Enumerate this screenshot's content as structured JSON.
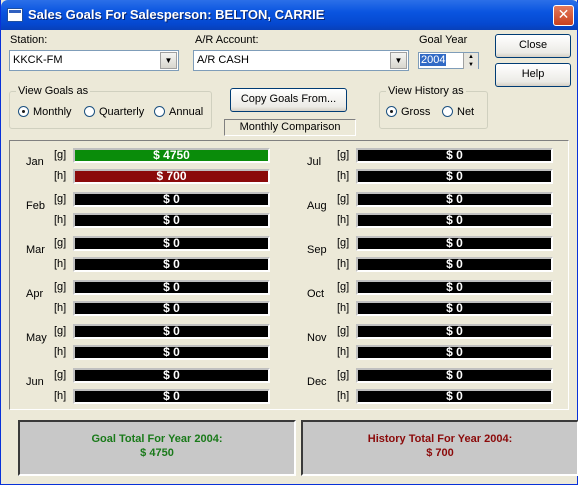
{
  "window": {
    "title": "Sales Goals For Salesperson: BELTON, CARRIE",
    "close_glyph": "✕"
  },
  "station": {
    "label": "Station:",
    "value": "KKCK-FM"
  },
  "ar_account": {
    "label": "A/R Account:",
    "value": "A/R CASH"
  },
  "goal_year": {
    "label": "Goal Year",
    "value": "2004"
  },
  "buttons": {
    "close": "Close",
    "help": "Help",
    "copy_goals": "Copy Goals From..."
  },
  "view_goals": {
    "title": "View Goals as",
    "options": [
      "Monthly",
      "Quarterly",
      "Annual"
    ],
    "selected": "Monthly"
  },
  "view_history": {
    "title": "View History as",
    "options": [
      "Gross",
      "Net"
    ],
    "selected": "Gross"
  },
  "comparison_label": "Monthly Comparison",
  "row_tags": {
    "goal": "[g]",
    "history": "[h]"
  },
  "months_left": [
    {
      "name": "Jan",
      "goal": "$ 4750",
      "history": "$ 700"
    },
    {
      "name": "Feb",
      "goal": "$ 0",
      "history": "$ 0"
    },
    {
      "name": "Mar",
      "goal": "$ 0",
      "history": "$ 0"
    },
    {
      "name": "Apr",
      "goal": "$ 0",
      "history": "$ 0"
    },
    {
      "name": "May",
      "goal": "$ 0",
      "history": "$ 0"
    },
    {
      "name": "Jun",
      "goal": "$ 0",
      "history": "$ 0"
    }
  ],
  "months_right": [
    {
      "name": "Jul",
      "goal": "$ 0",
      "history": "$ 0"
    },
    {
      "name": "Aug",
      "goal": "$ 0",
      "history": "$ 0"
    },
    {
      "name": "Sep",
      "goal": "$ 0",
      "history": "$ 0"
    },
    {
      "name": "Oct",
      "goal": "$ 0",
      "history": "$ 0"
    },
    {
      "name": "Nov",
      "goal": "$ 0",
      "history": "$ 0"
    },
    {
      "name": "Dec",
      "goal": "$ 0",
      "history": "$ 0"
    }
  ],
  "totals": {
    "goal_label": "Goal Total For Year 2004:",
    "goal_value": "$ 4750",
    "history_label": "History Total For Year 2004:",
    "history_value": "$ 700"
  },
  "colors": {
    "goal_text": "#1a7a1a",
    "history_text": "#8b0a0a",
    "goal_bar": "#0a8c0a",
    "history_bar": "#8b0a0a"
  }
}
